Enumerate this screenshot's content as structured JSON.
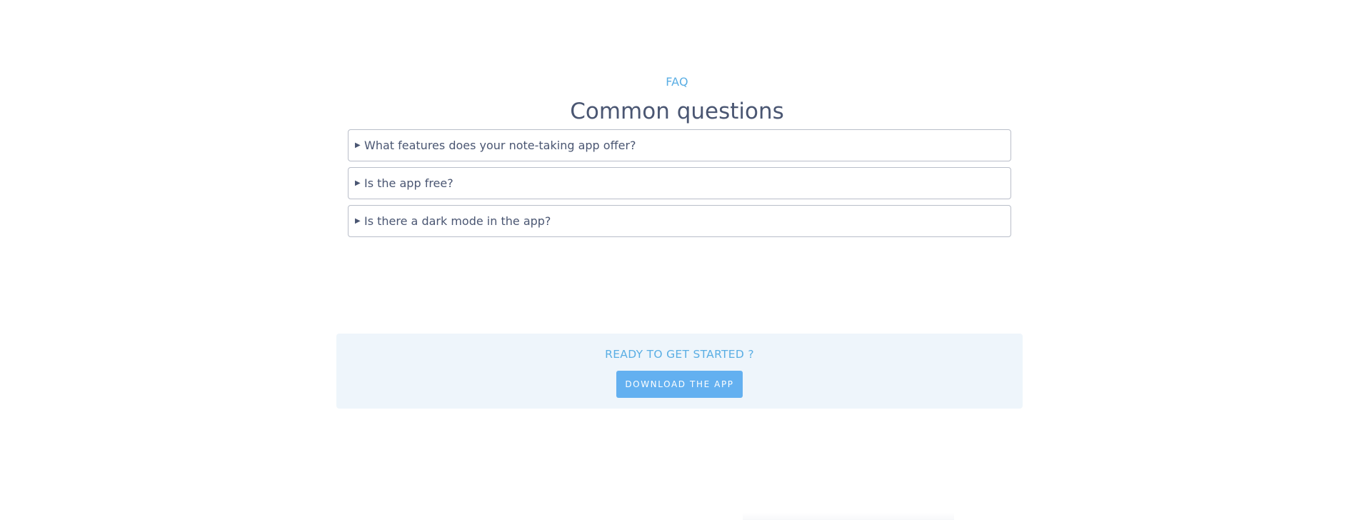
{
  "faq": {
    "eyebrow": "FAQ",
    "title": "Common questions",
    "caret": "▶",
    "items": [
      {
        "question": "What features does your note-taking app offer?"
      },
      {
        "question": "Is the app free?"
      },
      {
        "question": "Is there a dark mode in the app?"
      }
    ]
  },
  "cta": {
    "title": "READY TO GET STARTED ?",
    "button_label": "DOWNLOAD THE APP"
  },
  "colors": {
    "accent": "#5aaee4",
    "button": "#63b0f0",
    "text": "#4a5672",
    "cta_background": "#eef5fb",
    "border": "#b9bec9"
  }
}
